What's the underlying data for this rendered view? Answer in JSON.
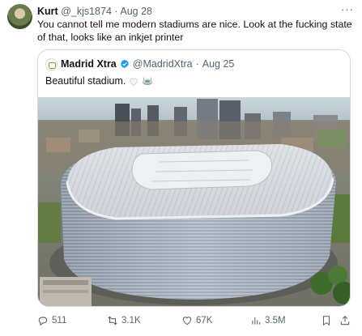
{
  "author": {
    "name": "Kurt",
    "handle": "@_kjs1874",
    "separator": "·",
    "date": "Aug 28"
  },
  "more_label": "···",
  "tweet_text": "You cannot tell me modern stadiums are nice. Look at the fucking state of that, looks like an inkjet printer",
  "quoted": {
    "name": "Madrid Xtra",
    "handle": "@MadridXtra",
    "separator": "·",
    "date": "Aug 25",
    "text": "Beautiful stadium.",
    "icons": [
      "club-crest-icon",
      "verified-badge-icon",
      "white-heart-icon",
      "stadium-icon"
    ]
  },
  "actions": {
    "replies": "511",
    "retweets": "3.1K",
    "likes": "67K",
    "views": "3.5M"
  },
  "action_icons": [
    "reply-icon",
    "retweet-icon",
    "like-icon",
    "views-icon",
    "bookmark-icon",
    "share-icon"
  ],
  "colors": {
    "text_primary": "#0f1419",
    "text_secondary": "#536471",
    "border": "#cfd9de",
    "verified": "#1d9bf0"
  }
}
